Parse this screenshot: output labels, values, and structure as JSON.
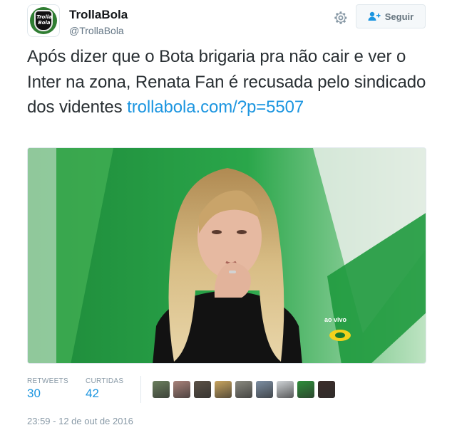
{
  "account": {
    "name": "TrollaBola",
    "handle": "@TrollaBola",
    "avatar_text": "Trolla Bola",
    "avatar_icon": "trollabola-logo"
  },
  "actions": {
    "settings_icon": "gear-icon",
    "follow_label": "Seguir",
    "follow_icon": "add-user-icon"
  },
  "tweet": {
    "text": "Após dizer que o Bota brigaria pra não cair e ver o Inter na zona, Renata Fan é recusada pelo sindicado dos videntes ",
    "link": "trollabola.com/?p=5507",
    "media": {
      "overlay_text": "ao vivo",
      "overlay_icon": "band-logo"
    }
  },
  "stats": {
    "retweets_label": "RETWEETS",
    "retweets_value": "30",
    "likes_label": "CURTIDAS",
    "likes_value": "42"
  },
  "likers": [
    {
      "color": "#6b7f5e"
    },
    {
      "color": "#a9827a"
    },
    {
      "color": "#5b5146"
    },
    {
      "color": "#c9a55f"
    },
    {
      "color": "#8a8a80"
    },
    {
      "color": "#7d8fa3"
    },
    {
      "color": "#cfd3d6"
    },
    {
      "color": "#2f8f3a"
    },
    {
      "color": "#3b2d2a"
    }
  ],
  "timestamp": "23:59 - 12 de out de 2016",
  "colors": {
    "link": "#1b95e0",
    "meta": "#8899a6"
  }
}
